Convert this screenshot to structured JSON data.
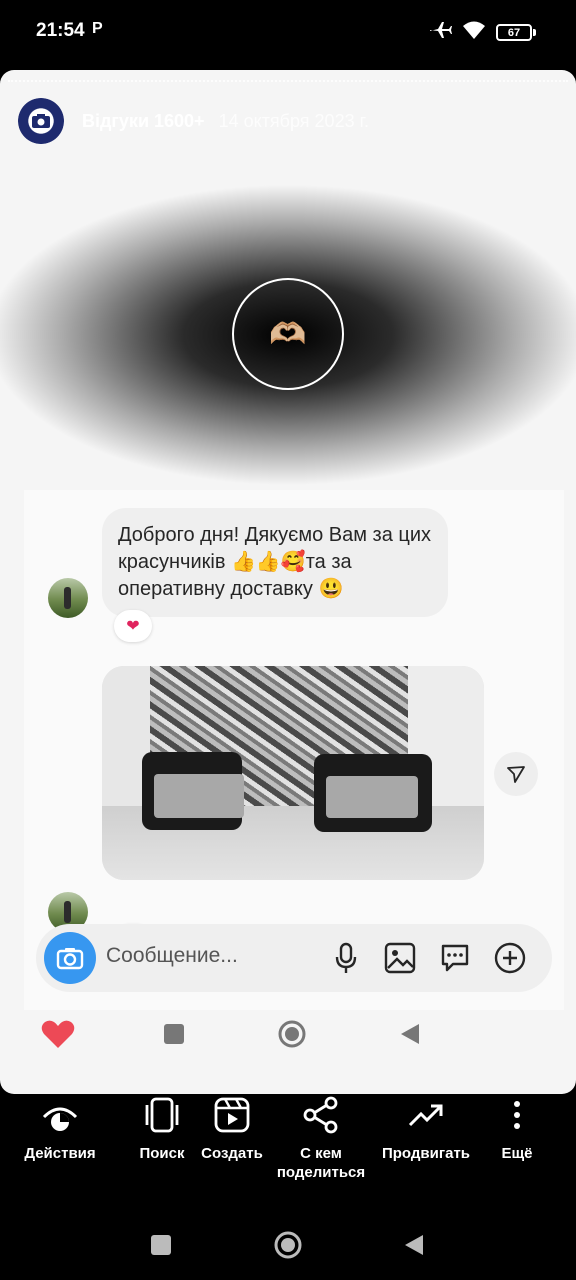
{
  "status_bar": {
    "time": "21:54",
    "carrier_icon_text": "P",
    "battery": "67",
    "icons": [
      "airplane-icon",
      "wifi-icon",
      "battery-icon"
    ]
  },
  "story": {
    "username": "Відгуки 1600+",
    "date": "14 октября 2023 г.",
    "sticker": "🫶🏼",
    "message_text": "Доброго дня! Дякуємо Вам за цих красунчиків 👍👍🥰та за оперативну доставку 😃",
    "reaction_1": "❤",
    "reaction_2": "❤"
  },
  "composer": {
    "placeholder": "Сообщение..."
  },
  "actions": [
    {
      "icon": "activity-icon",
      "label": "Действия"
    },
    {
      "icon": "search-icon",
      "label": "Поиск"
    },
    {
      "icon": "create-icon",
      "label": "Создать"
    },
    {
      "icon": "share-icon",
      "label": "С кем поделиться"
    },
    {
      "icon": "promote-icon",
      "label": "Продвигать"
    },
    {
      "icon": "more-icon",
      "label": "Ещё"
    }
  ],
  "colors": {
    "accent_blue": "#3797f0",
    "heart_red": "#e0245e"
  }
}
